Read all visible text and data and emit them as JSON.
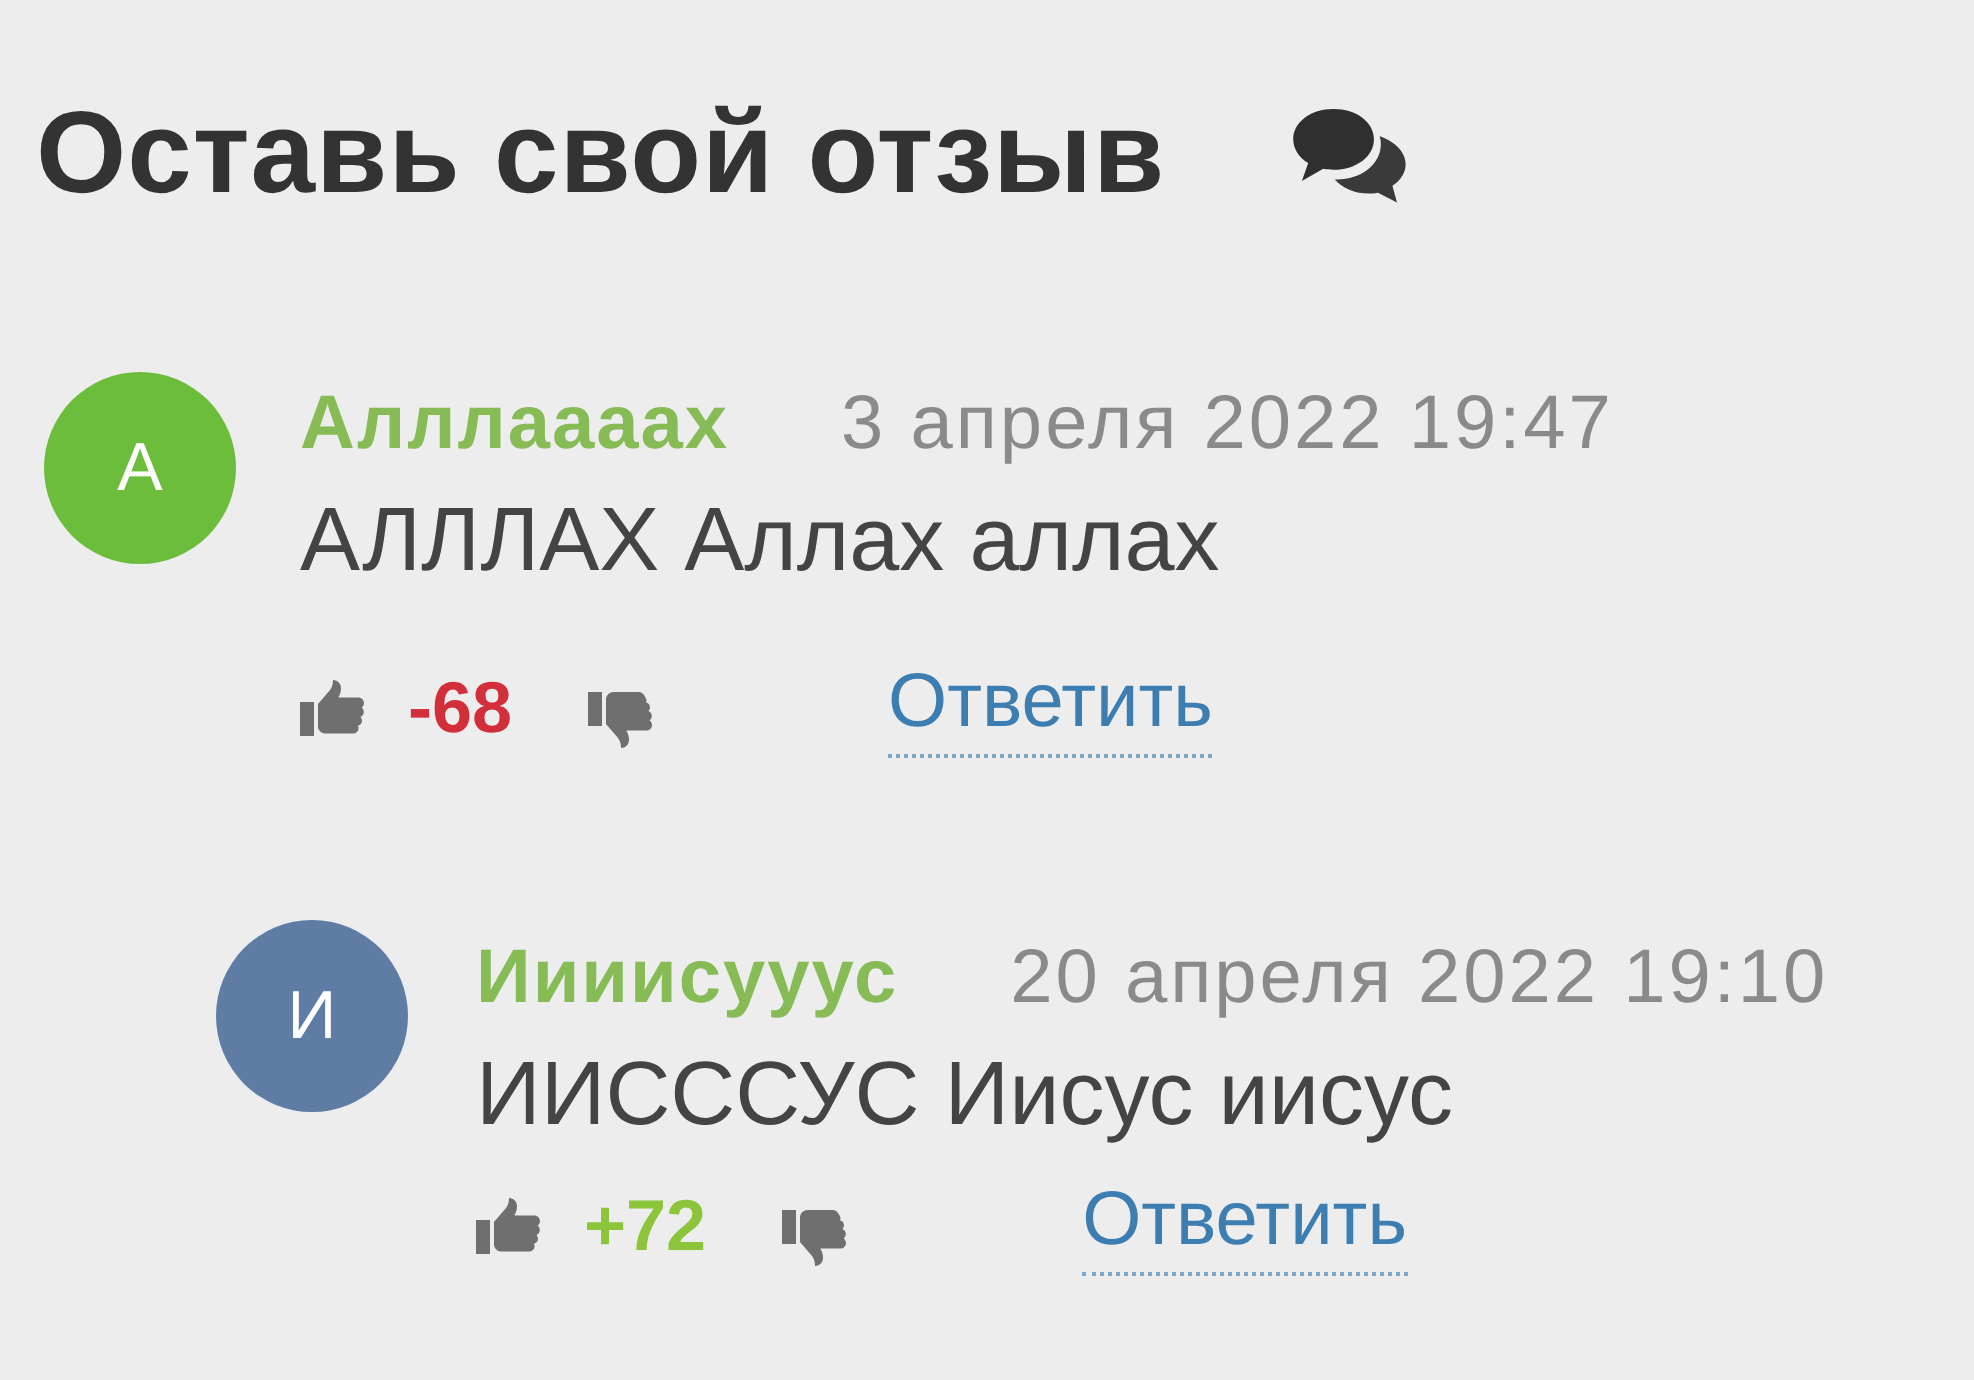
{
  "title": "Оставь свой отзыв",
  "comments": [
    {
      "author": "Алллаааах",
      "avatar_letter": "А",
      "color": "#6dbd3c",
      "date": "3 апреля 2022 19:47",
      "text": "АЛЛЛАХ Аллах аллах",
      "score": {
        "text": "-68",
        "color": "#d32f3a"
      },
      "reply": "Ответить",
      "children": [
        {
          "author": "Иииисууус",
          "avatar_letter": "И",
          "color": "#5f7ca5",
          "date": "20 апреля 2022 19:10",
          "text": "ИИСССУС Иисус иисус",
          "score": {
            "text": "+72",
            "color": "#8cc43c"
          },
          "reply": "Ответить"
        }
      ]
    }
  ]
}
